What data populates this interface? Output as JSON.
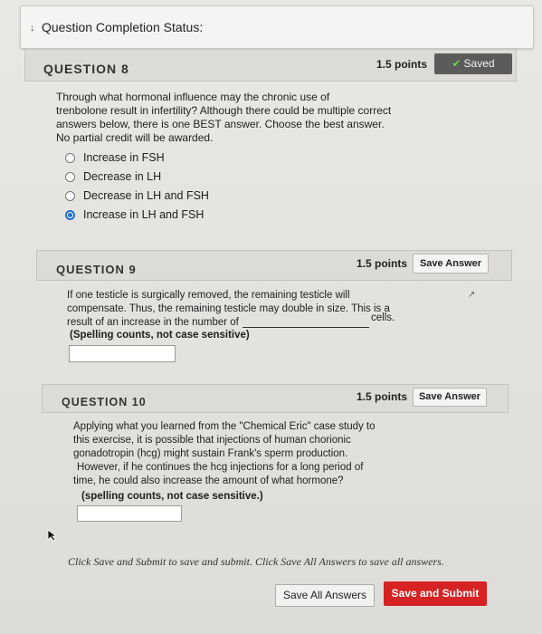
{
  "status": {
    "label": "Question Completion Status:"
  },
  "q8": {
    "title": "QUESTION 8",
    "points": "1.5 points",
    "saved": "Saved",
    "text_lines": [
      "Through what hormonal influence may the chronic use of",
      "trenbolone result in infertility? Although there could be multiple correct",
      "answers below, there is one BEST answer. Choose the best answer.",
      "No partial credit will be awarded."
    ],
    "options": [
      {
        "label": "Increase in FSH",
        "selected": false
      },
      {
        "label": "Decrease in LH",
        "selected": false
      },
      {
        "label": "Decrease in LH and FSH",
        "selected": false
      },
      {
        "label": "Increase in LH and FSH",
        "selected": true
      }
    ]
  },
  "q9": {
    "title": "QUESTION 9",
    "points": "1.5 points",
    "save_label": "Save Answer",
    "line1": "If one testicle is surgically removed, the remaining testicle will",
    "line2": "compensate. Thus, the remaining testicle may double in size. This is a",
    "line3": "result of an increase in the number of",
    "line3_end": "cells.",
    "line4": "(Spelling counts, not case sensitive)",
    "answer": ""
  },
  "q10": {
    "title": "QUESTION 10",
    "points": "1.5 points",
    "save_label": "Save Answer",
    "text_lines": [
      "Applying what you learned from the \"Chemical Eric\" case study to",
      "this exercise, it is possible that injections of human chorionic",
      "gonadotropin (hcg) might sustain Frank's sperm production.",
      "However, if he continues the hcg injections for a long period of",
      "time, he could also increase the amount of what hormone?"
    ],
    "note": "(spelling counts, not case sensitive.)",
    "answer": ""
  },
  "footer": {
    "instructions": "Click Save and Submit to save and submit. Click Save All Answers to save all answers.",
    "save_all_label": "Save All Answers",
    "submit_label": "Save and Submit"
  },
  "colors": {
    "submit": "#d62222",
    "selected_radio": "#1f6fd0",
    "saved_check": "#6fcf4a"
  }
}
